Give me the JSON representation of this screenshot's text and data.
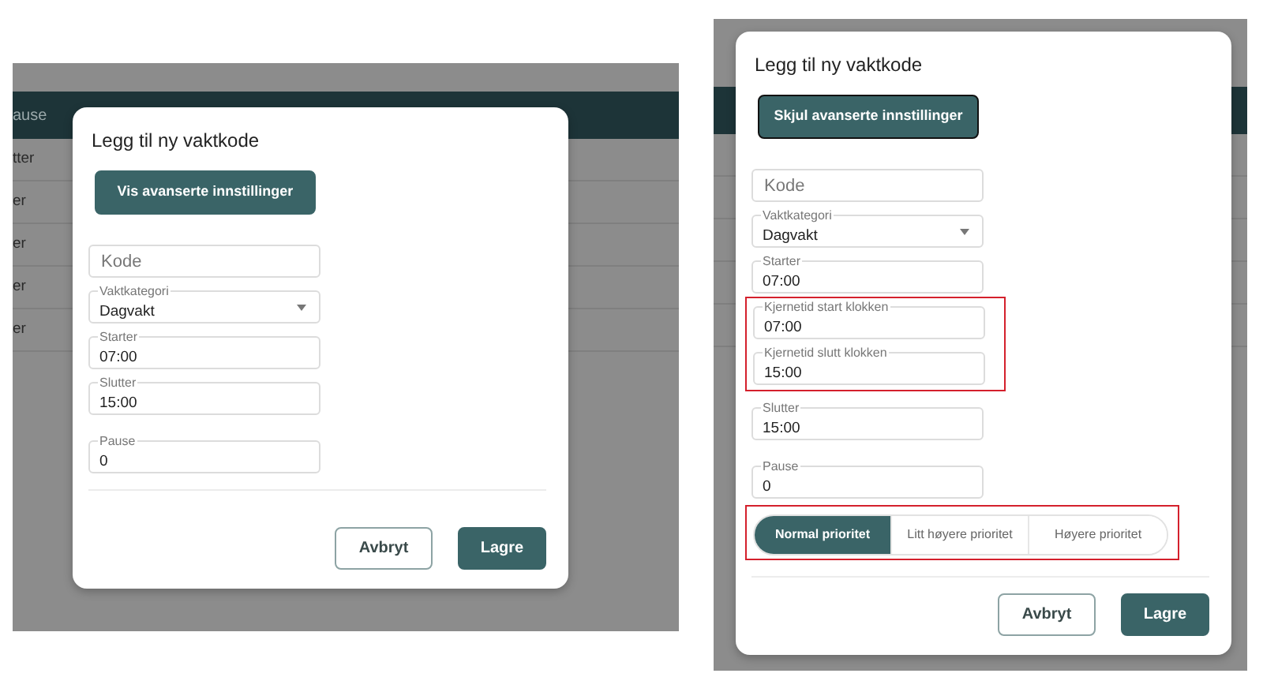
{
  "panels": [
    {
      "backdrop": {
        "header": [
          "ause"
        ],
        "rows": [
          [
            "tter"
          ],
          [
            "er"
          ],
          [
            "er"
          ],
          [
            "er"
          ],
          [
            "er"
          ]
        ]
      },
      "dialog": {
        "title": "Legg til ny vaktkode",
        "toggle_button": {
          "label": "Vis avanserte innstillinger",
          "focused": false
        },
        "field_groups": [
          {
            "highlighted": false,
            "fields": [
              {
                "kind": "text",
                "placeholder": "Kode"
              },
              {
                "kind": "select",
                "label": "Vaktkategori",
                "value": "Dagvakt"
              },
              {
                "kind": "time",
                "label": "Starter",
                "value": "07:00"
              },
              {
                "kind": "time",
                "label": "Slutter",
                "value": "15:00"
              },
              {
                "kind": "number",
                "label": "Pause",
                "value": "0"
              }
            ]
          }
        ],
        "buttons": [
          {
            "label": "Avbryt",
            "kind": "secondary"
          },
          {
            "label": "Lagre",
            "kind": "primary"
          }
        ]
      }
    },
    {
      "dialog": {
        "title": "Legg til ny vaktkode",
        "toggle_button": {
          "label": "Skjul avanserte innstillinger",
          "focused": true
        },
        "field_groups": [
          {
            "highlighted": false,
            "fields": [
              {
                "kind": "text",
                "placeholder": "Kode"
              },
              {
                "kind": "select",
                "label": "Vaktkategori",
                "value": "Dagvakt"
              },
              {
                "kind": "time",
                "label": "Starter",
                "value": "07:00"
              }
            ]
          },
          {
            "highlighted": true,
            "fields": [
              {
                "kind": "time",
                "label": "Kjernetid start klokken",
                "value": "07:00"
              },
              {
                "kind": "time",
                "label": "Kjernetid slutt klokken",
                "value": "15:00"
              }
            ]
          },
          {
            "highlighted": false,
            "fields": [
              {
                "kind": "time",
                "label": "Slutter",
                "value": "15:00"
              },
              {
                "kind": "number",
                "label": "Pause",
                "value": "0"
              }
            ]
          }
        ],
        "priority": {
          "highlighted": true,
          "options": [
            {
              "label": "Normal prioritet",
              "selected": true
            },
            {
              "label": "Litt høyere prioritet",
              "selected": false
            },
            {
              "label": "Høyere prioritet",
              "selected": false
            }
          ]
        },
        "buttons": [
          {
            "label": "Avbryt",
            "kind": "secondary"
          },
          {
            "label": "Lagre",
            "kind": "primary"
          }
        ]
      }
    }
  ]
}
